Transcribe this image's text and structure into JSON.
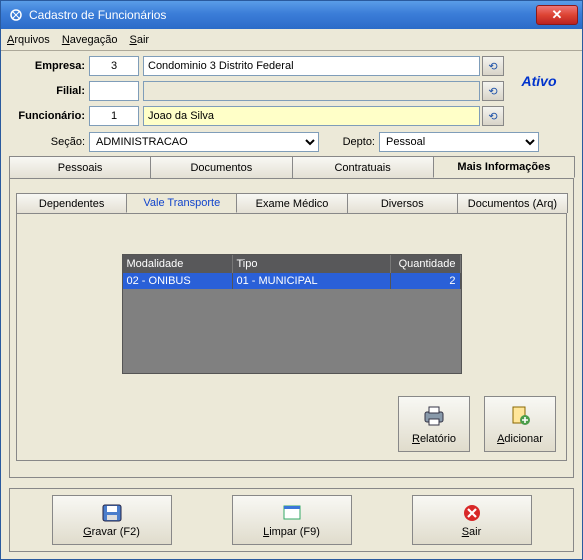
{
  "window": {
    "title": "Cadastro de Funcionários"
  },
  "menu": {
    "arquivos": "Arquivos",
    "navegacao": "Navegação",
    "sair": "Sair"
  },
  "status": "Ativo",
  "fields": {
    "empresa_label": "Empresa:",
    "empresa_num": "3",
    "empresa_text": "Condominio 3 Distrito Federal",
    "filial_label": "Filial:",
    "filial_num": "",
    "filial_text": "",
    "funcionario_label": "Funcionário:",
    "funcionario_num": "1",
    "funcionario_text": "Joao da Silva",
    "secao_label": "Seção:",
    "secao_value": "ADMINISTRACAO",
    "depto_label": "Depto:",
    "depto_value": "Pessoal"
  },
  "tabs_top": {
    "pessoais": "Pessoais",
    "documentos": "Documentos",
    "contratuais": "Contratuais",
    "mais_info": "Mais Informações"
  },
  "tabs_sub": {
    "dependentes": "Dependentes",
    "vale_transporte": "Vale Transporte",
    "exame_medico": "Exame Médico",
    "diversos": "Diversos",
    "documentos_arq": "Documentos (Arq)"
  },
  "grid": {
    "headers": {
      "modalidade": "Modalidade",
      "tipo": "Tipo",
      "quantidade": "Quantidade"
    },
    "row": {
      "modalidade": "02 - ONIBUS",
      "tipo": "01 - MUNICIPAL",
      "quantidade": "2"
    }
  },
  "actions": {
    "relatorio": "Relatório",
    "adicionar": "Adicionar"
  },
  "bottom": {
    "gravar": "Gravar (F2)",
    "limpar": "Limpar (F9)",
    "sair": "Sair"
  }
}
